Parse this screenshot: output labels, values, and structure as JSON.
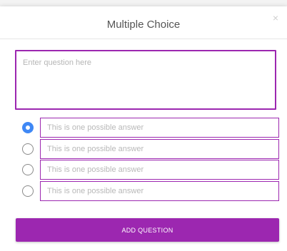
{
  "dialog": {
    "title": "Multiple Choice",
    "close_symbol": "×"
  },
  "question": {
    "placeholder": "Enter question here",
    "value": ""
  },
  "answers": [
    {
      "placeholder": "This is one possible answer",
      "value": "",
      "selected": true
    },
    {
      "placeholder": "This is one possible answer",
      "value": "",
      "selected": false
    },
    {
      "placeholder": "This is one possible answer",
      "value": "",
      "selected": false
    },
    {
      "placeholder": "This is one possible answer",
      "value": "",
      "selected": false
    }
  ],
  "actions": {
    "add_label": "ADD QUESTION"
  },
  "colors": {
    "accent": "#9c27b0",
    "radio_selected": "#3f88f5"
  },
  "icons": {
    "close": "close-icon",
    "radio": "radio-button-icon"
  }
}
